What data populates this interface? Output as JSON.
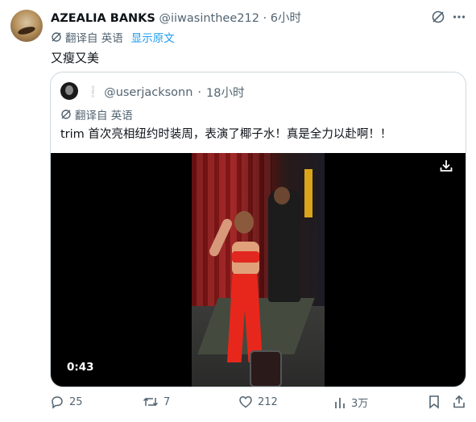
{
  "tweet": {
    "author_name": "AZEALIA BANKS",
    "handle": "@iiwasinthee212",
    "separator": "·",
    "time": "6小时",
    "translated_from": "翻译自 英语",
    "show_original": "显示原文",
    "text": "又瘦又美"
  },
  "quote": {
    "badge": "❕",
    "handle": "@userjacksonn",
    "separator": "·",
    "time": "18小时",
    "translated_from": "翻译自 英语",
    "text": "trim 首次亮相纽约时装周，表演了椰子水！真是全力以赴啊！！",
    "video": {
      "duration": "0:43"
    }
  },
  "actions": {
    "reply_count": "25",
    "retweet_count": "7",
    "like_count": "212",
    "view_count": "3万"
  },
  "colors": {
    "link": "#1d9bf0",
    "muted": "#536471",
    "border": "#cfd9de"
  }
}
